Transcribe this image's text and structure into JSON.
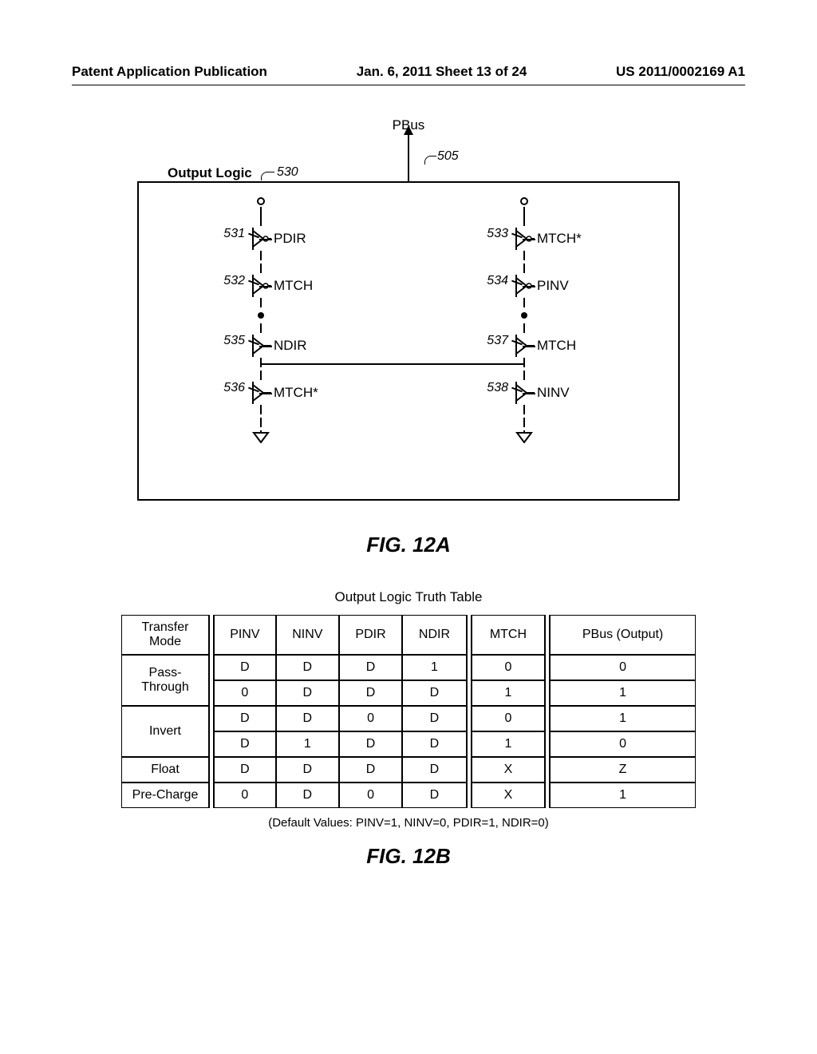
{
  "header": {
    "left": "Patent Application Publication",
    "center": "Jan. 6, 2011   Sheet 13 of 24",
    "right": "US 2011/0002169 A1"
  },
  "diagram": {
    "pbus": "PBus",
    "box_title": "Output Logic",
    "ref_530": "530",
    "ref_505": "505",
    "left_stack": [
      {
        "ref": "531",
        "sig": "PDIR"
      },
      {
        "ref": "532",
        "sig": "MTCH"
      },
      {
        "ref": "535",
        "sig": "NDIR"
      },
      {
        "ref": "536",
        "sig": "MTCH*"
      }
    ],
    "right_stack": [
      {
        "ref": "533",
        "sig": "MTCH*"
      },
      {
        "ref": "534",
        "sig": "PINV"
      },
      {
        "ref": "537",
        "sig": "MTCH"
      },
      {
        "ref": "538",
        "sig": "NINV"
      }
    ],
    "caption": "FIG. 12A"
  },
  "table": {
    "title": "Output Logic Truth Table",
    "headers": [
      "Transfer Mode",
      "PINV",
      "NINV",
      "PDIR",
      "NDIR",
      "MTCH",
      "PBus (Output)"
    ],
    "rows": [
      {
        "mode": "Pass-Through",
        "span": 2,
        "cells": [
          [
            "D",
            "D",
            "D",
            "1",
            "0",
            "0"
          ],
          [
            "0",
            "D",
            "D",
            "D",
            "1",
            "1"
          ]
        ]
      },
      {
        "mode": "Invert",
        "span": 2,
        "cells": [
          [
            "D",
            "D",
            "0",
            "D",
            "0",
            "1"
          ],
          [
            "D",
            "1",
            "D",
            "D",
            "1",
            "0"
          ]
        ]
      },
      {
        "mode": "Float",
        "span": 1,
        "cells": [
          [
            "D",
            "D",
            "D",
            "D",
            "X",
            "Z"
          ]
        ]
      },
      {
        "mode": "Pre-Charge",
        "span": 1,
        "cells": [
          [
            "0",
            "D",
            "0",
            "D",
            "X",
            "1"
          ]
        ]
      }
    ],
    "defaults": "(Default Values: PINV=1, NINV=0, PDIR=1, NDIR=0)",
    "caption": "FIG. 12B"
  }
}
